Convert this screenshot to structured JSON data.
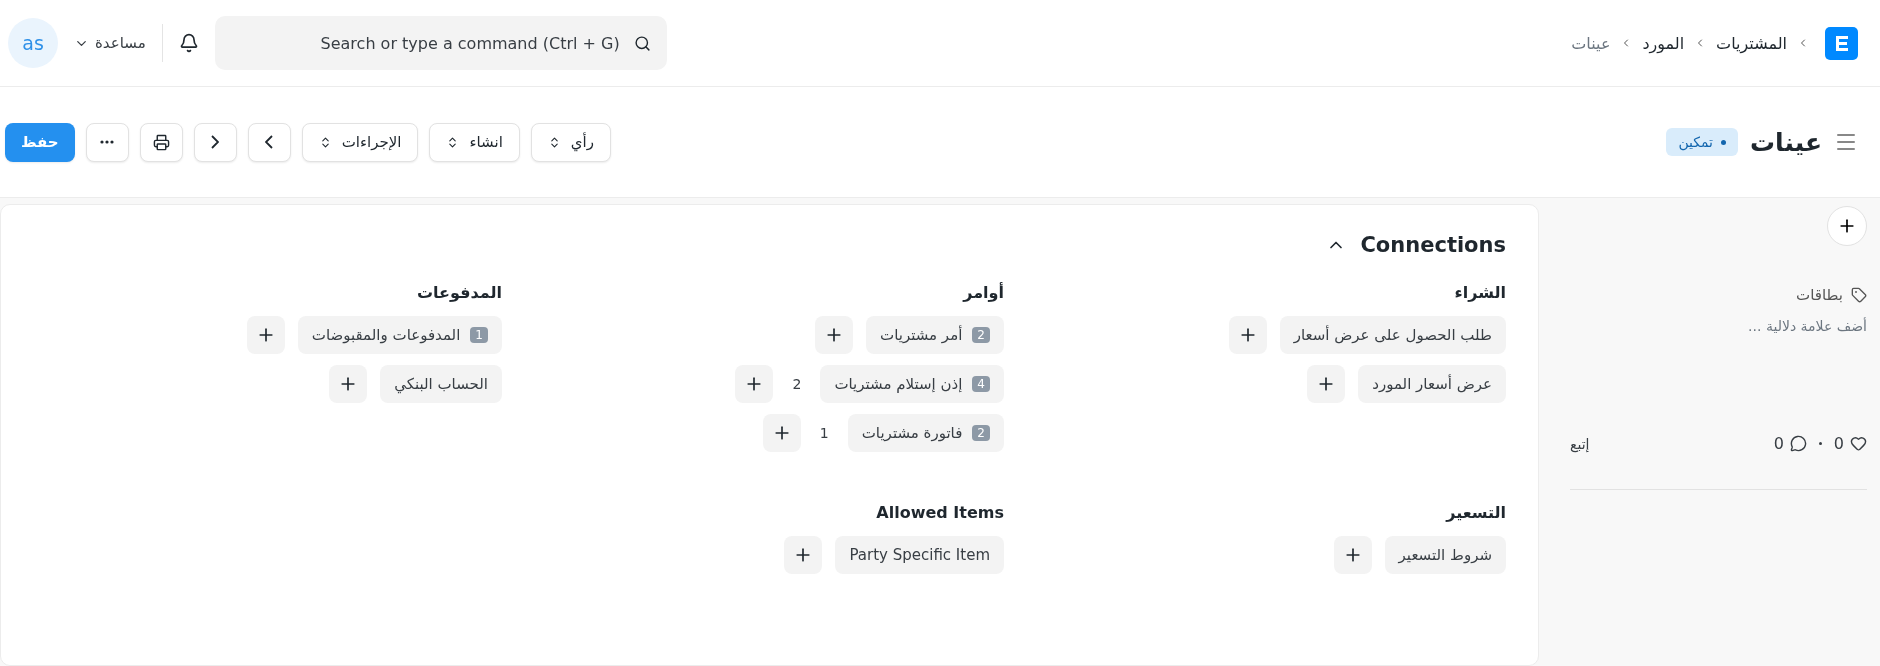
{
  "topbar": {
    "breadcrumbs": [
      "المشتريات",
      "المورد",
      "عينات"
    ],
    "search": {
      "placeholder": "Search or type a command (Ctrl + G)"
    },
    "help": "مساعدة",
    "avatar": "as"
  },
  "header": {
    "title": "عينات",
    "status": "تمكين",
    "actions": [
      {
        "kind": "select",
        "label": "رأي"
      },
      {
        "kind": "select",
        "label": "انشاء"
      },
      {
        "kind": "select",
        "label": "الإجراءات"
      },
      {
        "kind": "next"
      },
      {
        "kind": "prev"
      },
      {
        "kind": "print"
      },
      {
        "kind": "more"
      },
      {
        "kind": "primary",
        "label": "حفظ"
      }
    ]
  },
  "connections": {
    "title": "Connections",
    "expanded": true,
    "groups": [
      {
        "title": "الشراء",
        "items": [
          {
            "label": "طلب الحصول على عرض أسعار"
          },
          {
            "label": "عرض أسعار المورد"
          }
        ]
      },
      {
        "title": "أوامر",
        "items": [
          {
            "label": "أمر مشتريات",
            "badge": "2"
          },
          {
            "label": "إذن إستلام مشتريات",
            "badge": "4",
            "count": "2"
          },
          {
            "label": "فاتورة مشتريات",
            "badge": "2",
            "count": "1"
          }
        ]
      },
      {
        "title": "المدفوعات",
        "items": [
          {
            "label": "المدفوعات والمقبوضات",
            "badge": "1"
          },
          {
            "label": "الحساب البنكي"
          }
        ]
      },
      {
        "title": "التسعير",
        "items": [
          {
            "label": "شروط التسعير"
          }
        ]
      },
      {
        "title": "Allowed Items",
        "items": [
          {
            "label": "Party Specific Item"
          }
        ]
      }
    ]
  },
  "sidebar": {
    "tags_label": "بطاقات",
    "tag_placeholder": "أضف علامة دلالية ...",
    "likes": "0",
    "comments": "0",
    "follow": "إتبع"
  }
}
